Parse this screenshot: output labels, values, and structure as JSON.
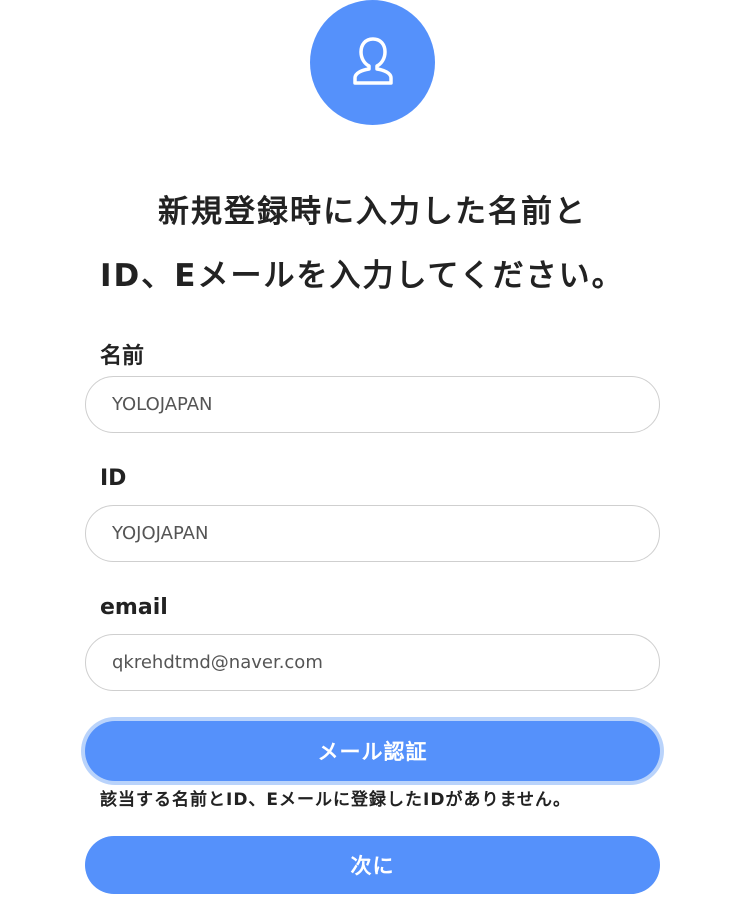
{
  "profile": {
    "icon": "user-icon",
    "color": "#5591fb"
  },
  "heading": {
    "line1": "新規登録時に入力した名前と",
    "line2": "ID、Eメールを入力してください。"
  },
  "form": {
    "name": {
      "label": "名前",
      "value": "YOLOJAPAN"
    },
    "id": {
      "label": "ID",
      "value": "YOJOJAPAN"
    },
    "email": {
      "label": "email",
      "value": "qkrehdtmd@naver.com"
    }
  },
  "buttons": {
    "verify_label": "メール認証",
    "next_label": "次に"
  },
  "error_message": "該当する名前とID、Eメールに登録したIDがありません。",
  "colors": {
    "accent": "#5591fb",
    "focus_ring": "#b9d3fb",
    "input_border": "#cfcfcf",
    "text": "#222222"
  }
}
